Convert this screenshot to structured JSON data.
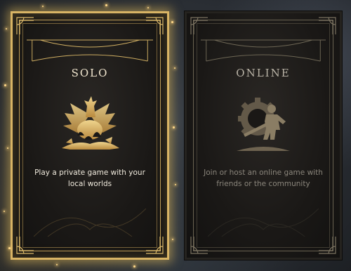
{
  "mode_select": {
    "cards": [
      {
        "id": "solo",
        "title": "SOLO",
        "description": "Play a private game with your local worlds",
        "icon": "dragon-emblem-icon",
        "selected": true
      },
      {
        "id": "online",
        "title": "ONLINE",
        "description": "Join or host an online game with friends or the community",
        "icon": "warrior-gear-emblem-icon",
        "selected": false
      }
    ]
  },
  "colors": {
    "gold_accent": "#d8b465",
    "card_dark": "#1a1816",
    "text_active": "#efe9dc",
    "text_inactive": "#8a857b"
  }
}
